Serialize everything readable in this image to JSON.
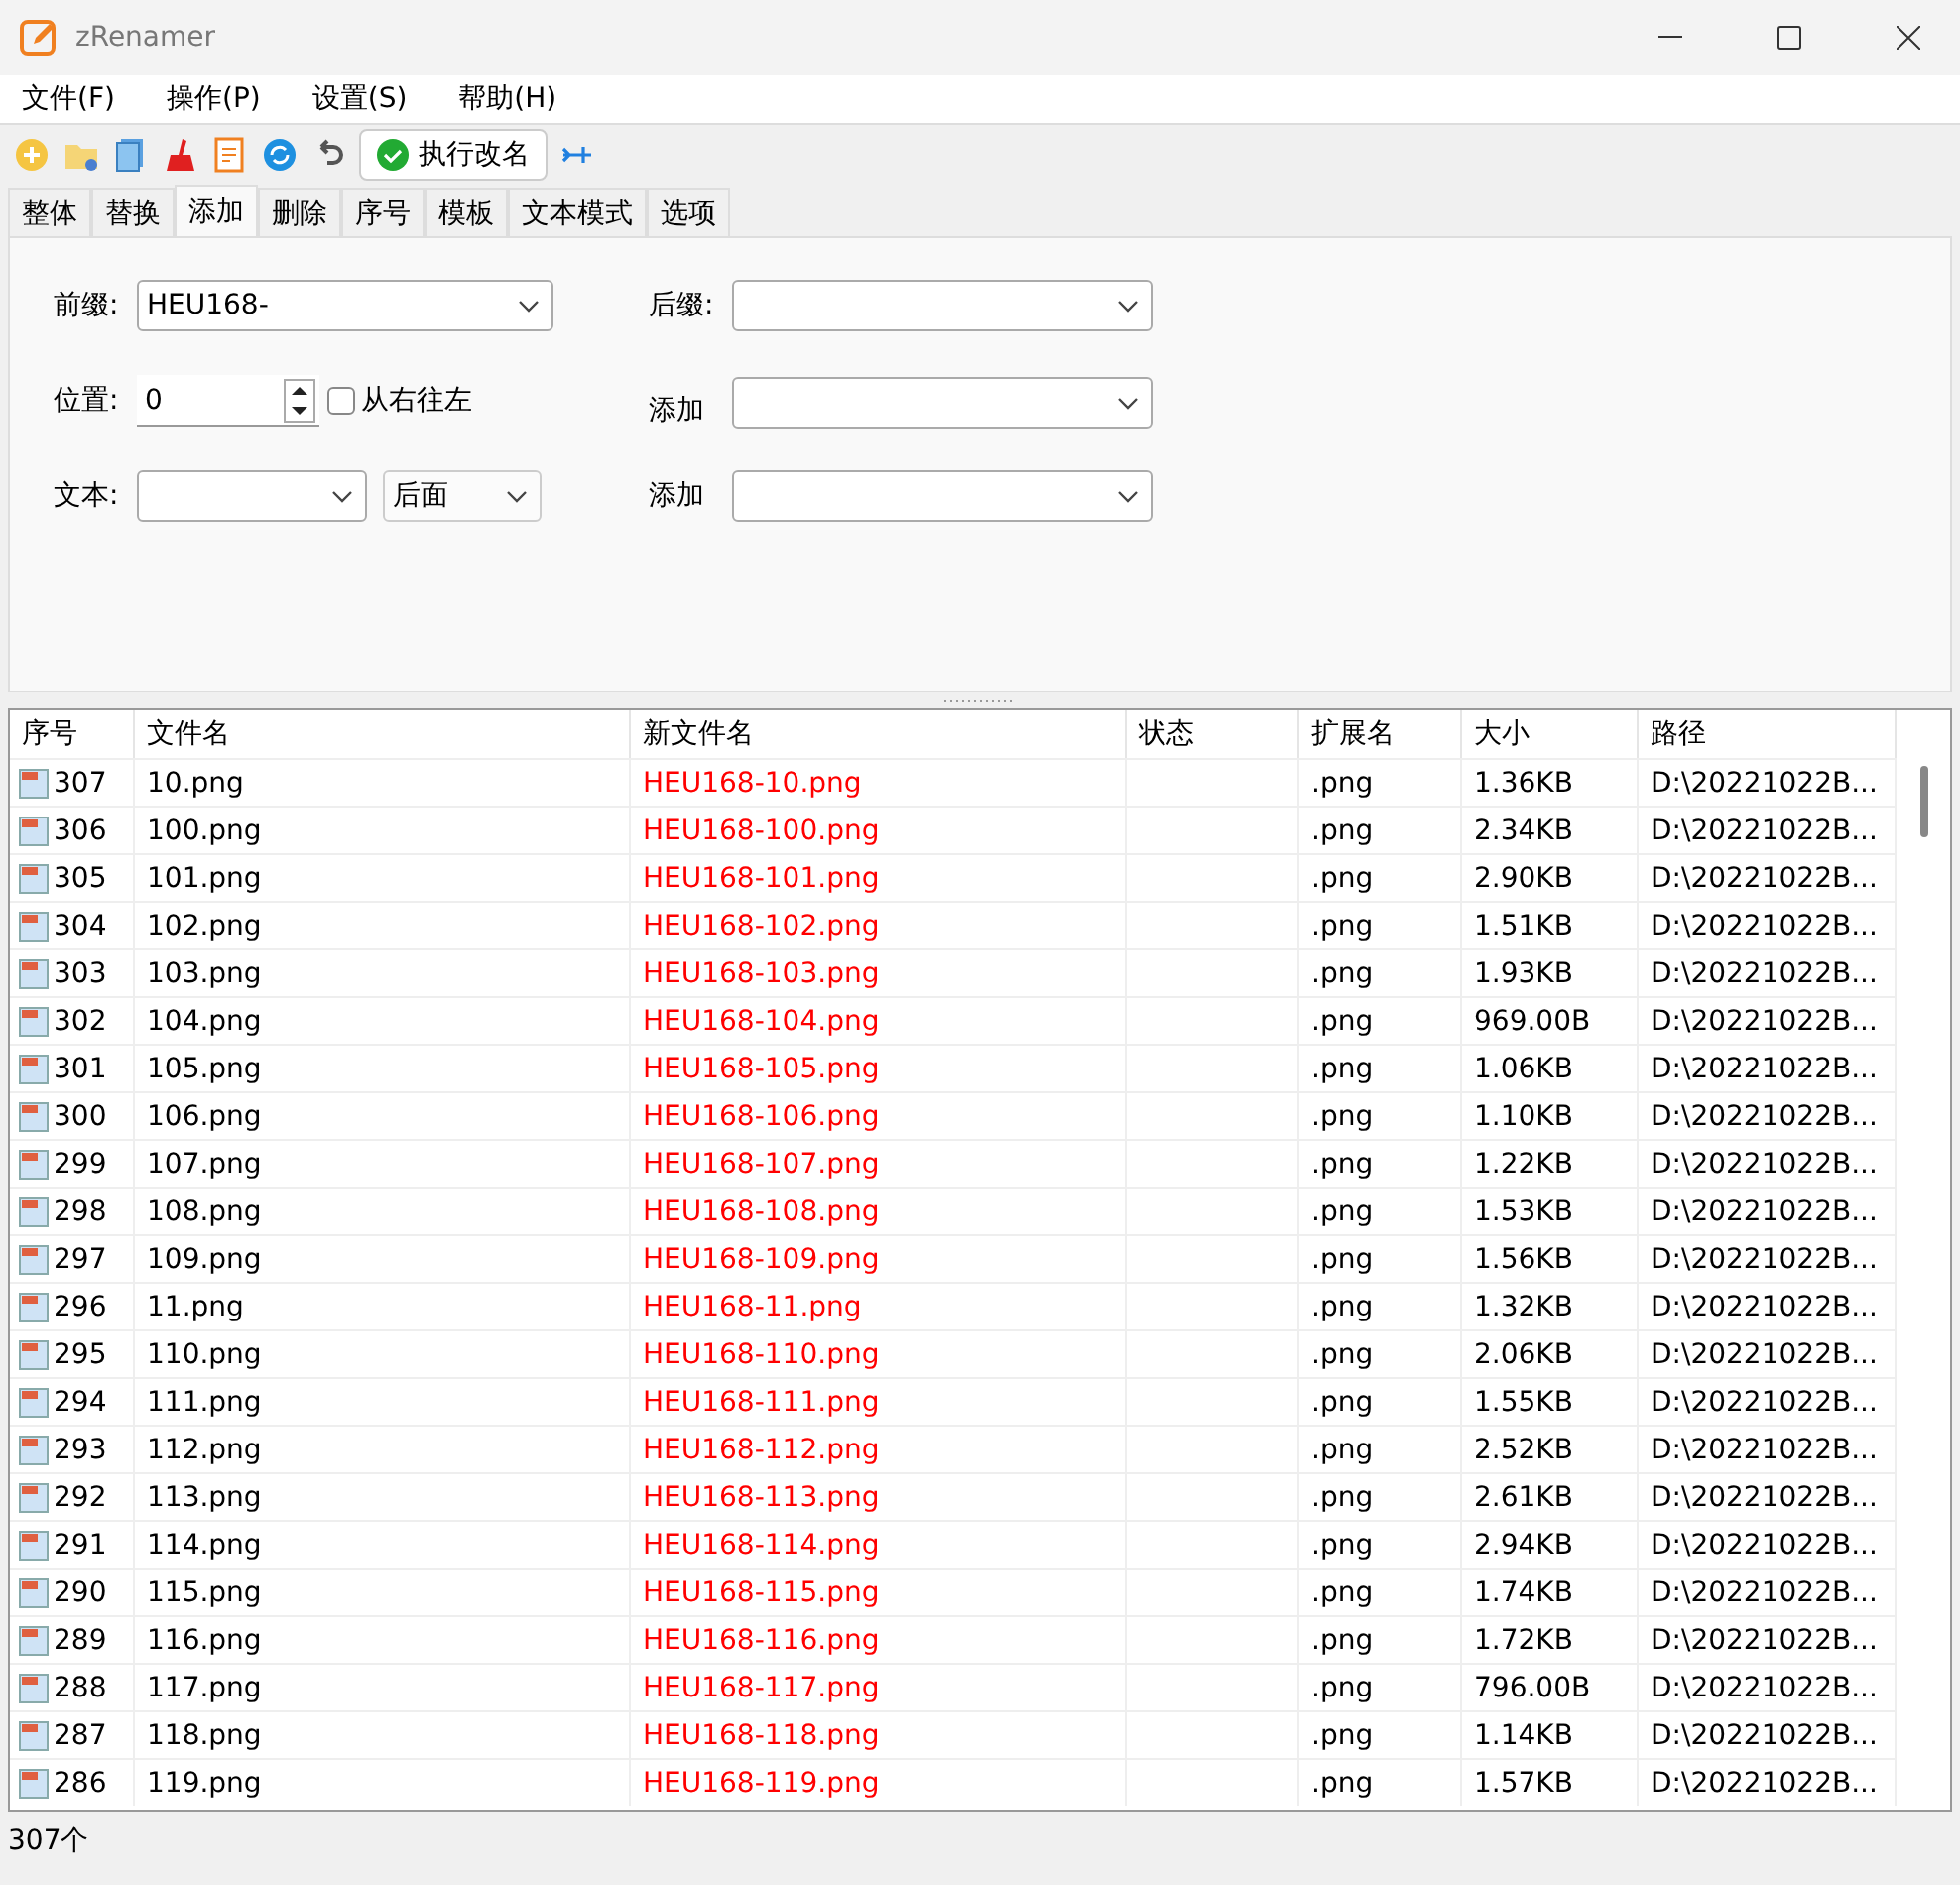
{
  "window": {
    "title": "zRenamer"
  },
  "menu": [
    "文件(F)",
    "操作(P)",
    "设置(S)",
    "帮助(H)"
  ],
  "toolbar": {
    "run_button": "执行改名"
  },
  "tabs": [
    {
      "label": "整体",
      "selected": false
    },
    {
      "label": "替换",
      "selected": false
    },
    {
      "label": "添加",
      "selected": true
    },
    {
      "label": "删除",
      "selected": false
    },
    {
      "label": "序号",
      "selected": false
    },
    {
      "label": "模板",
      "selected": false
    },
    {
      "label": "文本模式",
      "selected": false
    },
    {
      "label": "选项",
      "selected": false
    }
  ],
  "form": {
    "prefix_label": "前缀:",
    "prefix_value": "HEU168-",
    "suffix_label": "后缀:",
    "position_label": "位置:",
    "position_value": "0",
    "right_to_left": {
      "label": "从右往左",
      "checked": false
    },
    "add_label_1": "添加",
    "text_label": "文本:",
    "placement_value": "后面",
    "add_label_2": "添加"
  },
  "table": {
    "columns": [
      "序号",
      "文件名",
      "新文件名",
      "状态",
      "扩展名",
      "大小",
      "路径"
    ],
    "rows": [
      [
        "307",
        "10.png",
        "HEU168-10.png",
        "",
        ".png",
        "1.36KB",
        "D:\\20221022B..."
      ],
      [
        "306",
        "100.png",
        "HEU168-100.png",
        "",
        ".png",
        "2.34KB",
        "D:\\20221022B..."
      ],
      [
        "305",
        "101.png",
        "HEU168-101.png",
        "",
        ".png",
        "2.90KB",
        "D:\\20221022B..."
      ],
      [
        "304",
        "102.png",
        "HEU168-102.png",
        "",
        ".png",
        "1.51KB",
        "D:\\20221022B..."
      ],
      [
        "303",
        "103.png",
        "HEU168-103.png",
        "",
        ".png",
        "1.93KB",
        "D:\\20221022B..."
      ],
      [
        "302",
        "104.png",
        "HEU168-104.png",
        "",
        ".png",
        "969.00B",
        "D:\\20221022B..."
      ],
      [
        "301",
        "105.png",
        "HEU168-105.png",
        "",
        ".png",
        "1.06KB",
        "D:\\20221022B..."
      ],
      [
        "300",
        "106.png",
        "HEU168-106.png",
        "",
        ".png",
        "1.10KB",
        "D:\\20221022B..."
      ],
      [
        "299",
        "107.png",
        "HEU168-107.png",
        "",
        ".png",
        "1.22KB",
        "D:\\20221022B..."
      ],
      [
        "298",
        "108.png",
        "HEU168-108.png",
        "",
        ".png",
        "1.53KB",
        "D:\\20221022B..."
      ],
      [
        "297",
        "109.png",
        "HEU168-109.png",
        "",
        ".png",
        "1.56KB",
        "D:\\20221022B..."
      ],
      [
        "296",
        "11.png",
        "HEU168-11.png",
        "",
        ".png",
        "1.32KB",
        "D:\\20221022B..."
      ],
      [
        "295",
        "110.png",
        "HEU168-110.png",
        "",
        ".png",
        "2.06KB",
        "D:\\20221022B..."
      ],
      [
        "294",
        "111.png",
        "HEU168-111.png",
        "",
        ".png",
        "1.55KB",
        "D:\\20221022B..."
      ],
      [
        "293",
        "112.png",
        "HEU168-112.png",
        "",
        ".png",
        "2.52KB",
        "D:\\20221022B..."
      ],
      [
        "292",
        "113.png",
        "HEU168-113.png",
        "",
        ".png",
        "2.61KB",
        "D:\\20221022B..."
      ],
      [
        "291",
        "114.png",
        "HEU168-114.png",
        "",
        ".png",
        "2.94KB",
        "D:\\20221022B..."
      ],
      [
        "290",
        "115.png",
        "HEU168-115.png",
        "",
        ".png",
        "1.74KB",
        "D:\\20221022B..."
      ],
      [
        "289",
        "116.png",
        "HEU168-116.png",
        "",
        ".png",
        "1.72KB",
        "D:\\20221022B..."
      ],
      [
        "288",
        "117.png",
        "HEU168-117.png",
        "",
        ".png",
        "796.00B",
        "D:\\20221022B..."
      ],
      [
        "287",
        "118.png",
        "HEU168-118.png",
        "",
        ".png",
        "1.14KB",
        "D:\\20221022B..."
      ],
      [
        "286",
        "119.png",
        "HEU168-119.png",
        "",
        ".png",
        "1.57KB",
        "D:\\20221022B..."
      ]
    ]
  },
  "status_bar": "307个"
}
